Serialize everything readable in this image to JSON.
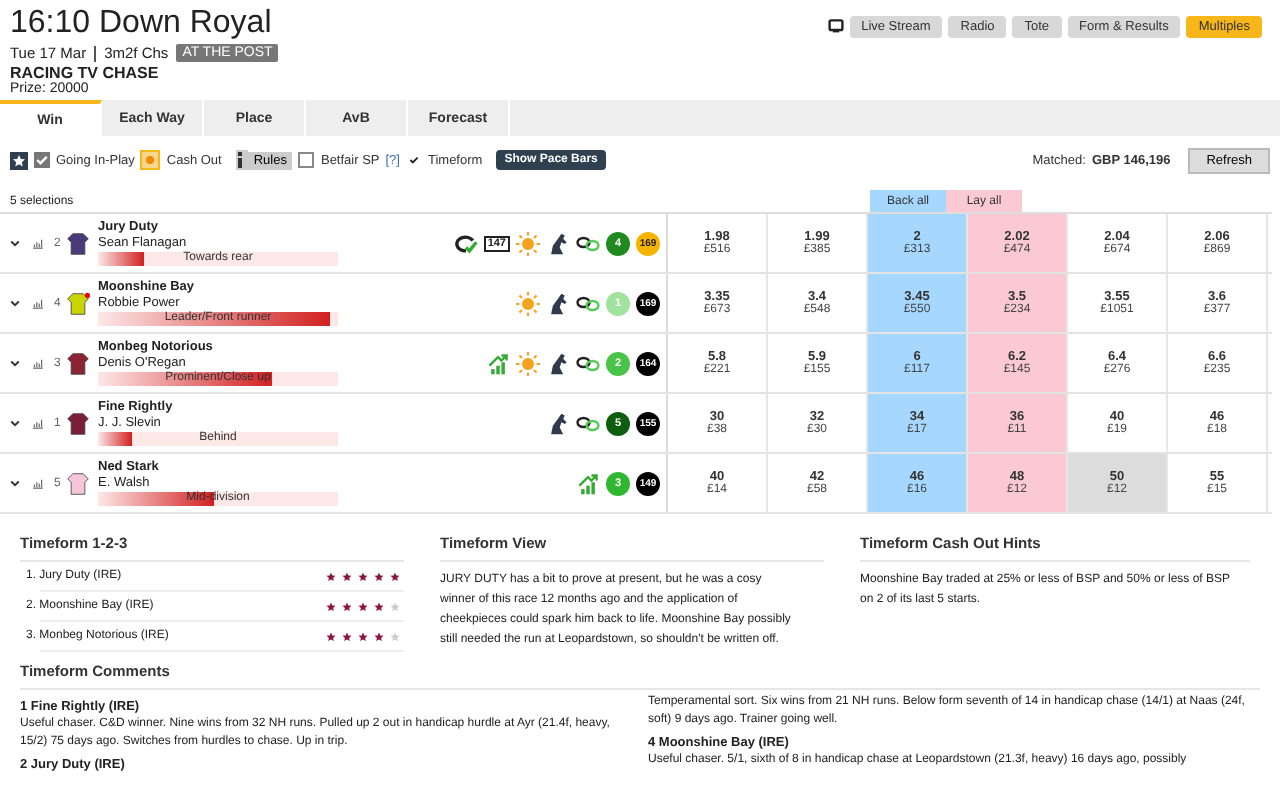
{
  "race": {
    "title": "16:10 Down Royal",
    "date": "Tue 17 Mar",
    "distance": "3m2f Chs",
    "status": "AT THE POST",
    "name": "RACING TV CHASE",
    "prize": "Prize: 20000"
  },
  "header_buttons": [
    {
      "label": "Live Stream",
      "kind": "stream",
      "highlighted": false
    },
    {
      "label": "Radio",
      "kind": "plain",
      "highlighted": false
    },
    {
      "label": "Tote",
      "kind": "plain",
      "highlighted": false
    },
    {
      "label": "Form & Results",
      "kind": "plain",
      "highlighted": false
    },
    {
      "label": "Multiples",
      "kind": "plain",
      "highlighted": true
    }
  ],
  "tabs": [
    {
      "label": "Win",
      "selected": true
    },
    {
      "label": "Each Way",
      "selected": false
    },
    {
      "label": "Place",
      "selected": false
    },
    {
      "label": "AvB",
      "selected": false
    },
    {
      "label": "Forecast",
      "selected": false
    }
  ],
  "toolbar": {
    "going_in_play": {
      "label": "Going In-Play",
      "checked": true
    },
    "cash_out": {
      "label": "Cash Out",
      "checked": true
    },
    "rules": "Rules",
    "betfair_sp": {
      "label": "Betfair SP",
      "checked": false
    },
    "help": "[?]",
    "timeform": {
      "label": "Timeform",
      "checked": true
    },
    "pace_button": "Show Pace Bars",
    "matched_label": "Matched:",
    "matched_value": "GBP 146,196",
    "refresh": "Refresh"
  },
  "market": {
    "selections": "5 selections",
    "back_all": "Back all",
    "lay_all": "Lay all"
  },
  "runners": [
    {
      "number": "2",
      "name": "Jury Duty",
      "jockey": "Sean Flanagan",
      "color": "#4a3a7a",
      "flag": false,
      "pace": {
        "label": "Towards rear",
        "level": 0.2
      },
      "icons": [
        {
          "kind": "course"
        },
        {
          "kind": "rating"
        },
        {
          "kind": "hot"
        },
        {
          "kind": "fav"
        },
        {
          "kind": "link"
        }
      ],
      "rating_box": "147",
      "tf_rating": {
        "value": "4",
        "color": "#1f8a1f"
      },
      "score": {
        "value": "169",
        "color": "#f5b400"
      },
      "prices": [
        {
          "price": "1.98",
          "amount": "£516",
          "highlighted": false
        },
        {
          "price": "1.99",
          "amount": "£385",
          "highlighted": false
        },
        {
          "price": "2",
          "amount": "£313",
          "highlighted": false
        },
        {
          "price": "2.02",
          "amount": "£474",
          "highlighted": false
        },
        {
          "price": "2.04",
          "amount": "£674",
          "highlighted": false
        },
        {
          "price": "2.06",
          "amount": "£869",
          "highlighted": false
        }
      ]
    },
    {
      "number": "4",
      "name": "Moonshine Bay",
      "jockey": "Robbie Power",
      "color": "#c8d400",
      "flag": true,
      "pace": {
        "label": "Leader/Front runner",
        "level": 1
      },
      "icons": [
        {
          "kind": "hot"
        },
        {
          "kind": "fav"
        },
        {
          "kind": "link"
        }
      ],
      "tf_rating": {
        "value": "1",
        "color": "#9fe39f"
      },
      "score": {
        "value": "169",
        "color": "#000000"
      },
      "prices": [
        {
          "price": "3.35",
          "amount": "£673",
          "highlighted": false
        },
        {
          "price": "3.4",
          "amount": "£548",
          "highlighted": false
        },
        {
          "price": "3.45",
          "amount": "£550",
          "highlighted": false
        },
        {
          "price": "3.5",
          "amount": "£234",
          "highlighted": false
        },
        {
          "price": "3.55",
          "amount": "£1051",
          "highlighted": false
        },
        {
          "price": "3.6",
          "amount": "£377",
          "highlighted": false
        }
      ]
    },
    {
      "number": "3",
      "name": "Monbeg Notorious",
      "jockey": "Denis O'Regan",
      "color": "#8b2332",
      "flag": false,
      "pace": {
        "label": "Prominent/Close up",
        "level": 0.75
      },
      "icons": [
        {
          "kind": "trend"
        },
        {
          "kind": "hot"
        },
        {
          "kind": "fav"
        },
        {
          "kind": "link"
        }
      ],
      "tf_rating": {
        "value": "2",
        "color": "#48c448"
      },
      "score": {
        "value": "164",
        "color": "#000000"
      },
      "prices": [
        {
          "price": "5.8",
          "amount": "£221",
          "highlighted": false
        },
        {
          "price": "5.9",
          "amount": "£155",
          "highlighted": false
        },
        {
          "price": "6",
          "amount": "£117",
          "highlighted": false
        },
        {
          "price": "6.2",
          "amount": "£145",
          "highlighted": false
        },
        {
          "price": "6.4",
          "amount": "£276",
          "highlighted": false
        },
        {
          "price": "6.6",
          "amount": "£235",
          "highlighted": false
        }
      ]
    },
    {
      "number": "1",
      "name": "Fine Rightly",
      "jockey": "J. J. Slevin",
      "color": "#7a1f3a",
      "flag": false,
      "pace": {
        "label": "Behind",
        "level": 0.15
      },
      "icons": [
        {
          "kind": "fav"
        },
        {
          "kind": "link"
        }
      ],
      "tf_rating": {
        "value": "5",
        "color": "#0d5e0d"
      },
      "score": {
        "value": "155",
        "color": "#000000"
      },
      "prices": [
        {
          "price": "30",
          "amount": "£38",
          "highlighted": false
        },
        {
          "price": "32",
          "amount": "£30",
          "highlighted": false
        },
        {
          "price": "34",
          "amount": "£17",
          "highlighted": false
        },
        {
          "price": "36",
          "amount": "£11",
          "highlighted": false
        },
        {
          "price": "40",
          "amount": "£19",
          "highlighted": false
        },
        {
          "price": "46",
          "amount": "£18",
          "highlighted": false
        }
      ]
    },
    {
      "number": "5",
      "name": "Ned Stark",
      "jockey": "E. Walsh",
      "color": "#f4c6d8",
      "flag": false,
      "pace": {
        "label": "Mid-division",
        "level": 0.5
      },
      "icons": [
        {
          "kind": "trend"
        }
      ],
      "tf_rating": {
        "value": "3",
        "color": "#2fb82f"
      },
      "score": {
        "value": "149",
        "color": "#000000"
      },
      "prices": [
        {
          "price": "40",
          "amount": "£14",
          "highlighted": false
        },
        {
          "price": "42",
          "amount": "£58",
          "highlighted": false
        },
        {
          "price": "46",
          "amount": "£16",
          "highlighted": false
        },
        {
          "price": "48",
          "amount": "£12",
          "highlighted": false
        },
        {
          "price": "50",
          "amount": "£12",
          "highlighted": true
        },
        {
          "price": "55",
          "amount": "£15",
          "highlighted": false
        }
      ]
    }
  ],
  "timeform_123": {
    "title": "Timeform 1-2-3",
    "picks": [
      {
        "label": "1. Jury Duty (IRE)",
        "stars": 5
      },
      {
        "label": "2. Moonshine Bay (IRE)",
        "stars": 4
      },
      {
        "label": "3. Monbeg Notorious (IRE)",
        "stars": 4
      }
    ]
  },
  "timeform_view": {
    "title": "Timeform View",
    "text": "JURY DUTY has a bit to prove at present, but he was a cosy winner of this race 12 months ago and the application of cheekpieces could spark him back to life. Moonshine Bay possibly still needed the run at Leopardstown, so shouldn't be written off."
  },
  "cash_out_hints": {
    "title": "Timeform Cash Out Hints",
    "text": "Moonshine Bay traded at 25% or less of BSP and 50% or less of BSP on 2 of its last 5 starts."
  },
  "comments": {
    "title": "Timeform Comments",
    "columns": [
      [
        {
          "title": "1 Fine Rightly (IRE)",
          "text": "Useful chaser. C&D winner. Nine wins from 32 NH runs. Pulled up 2 out in handicap hurdle at Ayr (21.4f, heavy, 15/2) 75 days ago. Switches from hurdles to chase. Up in trip."
        },
        {
          "title": "2 Jury Duty (IRE)"
        }
      ],
      [
        {
          "text": "Temperamental sort. Six wins from 21 NH runs. Below form seventh of 14 in handicap chase (14/1) at Naas (24f, soft) 9 days ago. Trainer going well."
        },
        {
          "title": "4 Moonshine Bay (IRE)",
          "text": "Useful chaser. 5/1, sixth of 8 in handicap chase at Leopardstown (21.3f, heavy) 16 days ago, possibly"
        }
      ]
    ]
  }
}
